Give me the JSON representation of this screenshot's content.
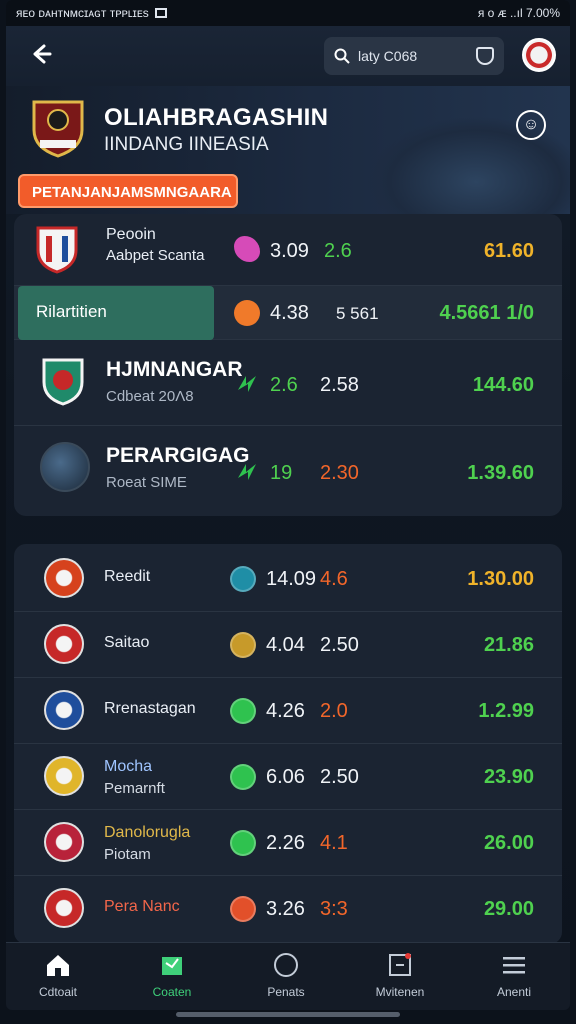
{
  "statusbar": {
    "left_text": "ᴙᴇᴏ ᴅᴀʜᴛɴᴍᴄɪᴀɢᴛ ᴛᴘᴘʟɪᴇs",
    "right_text": "ᴙ ᴏ ᴁ ..ıl 7.00%"
  },
  "search": {
    "text": "laty C068"
  },
  "hero": {
    "title": "OLIAHBRAGASHIN",
    "subtitle": "IINDANG IINEASIA",
    "badge": "PETANJANJAMSMNGAARA"
  },
  "featured": [
    {
      "name1": "Peooin",
      "name2": "Aabpet Scanta",
      "v1": "3.09",
      "v2": "2.6",
      "v3": "61.60",
      "v2_color": "#4fd14f",
      "v3_color": "#f0b32a",
      "icon_color": "#d64bb8"
    },
    {
      "name1": "Rilartitien",
      "name2": "",
      "v1": "4.38",
      "v2": "5 561",
      "v3": "4.5661 1/0",
      "v2_color": "#f0f3f7",
      "v3_color": "#4fd14f",
      "icon_color": "#f07a2a"
    },
    {
      "name1": "HJMNANGAR",
      "name2": "Cdbeat 20Ʌ8",
      "v1": "",
      "v2": "2.6",
      "v2b": "2.58",
      "v3": "144.60",
      "v2_color": "#4fd14f",
      "v3_color": "#4fd14f",
      "icon_color": "#2fc24f"
    },
    {
      "name1": "PERARGIGAG",
      "name2": "Roeat SIME",
      "v1": "",
      "v2": "19",
      "v2b": "2.30",
      "v3": "1.39.60",
      "v2_color": "#4fd14f",
      "v3_color": "#4fd14f",
      "icon_color": "#2fc24f"
    }
  ],
  "list": [
    {
      "name1": "Reedit",
      "name2": "",
      "v1": "14.09",
      "v2": "4.6",
      "v3": "1.30.00",
      "v2_color": "#f2662a",
      "v3_color": "#f0b32a",
      "icon_color": "#1f8ea6",
      "logo_color": "#d6421d"
    },
    {
      "name1": "Saitao",
      "name2": "",
      "v1": "4.04",
      "v2": "2.50",
      "v3": "21.86",
      "v2_color": "#f0f3f7",
      "v3_color": "#4fd14f",
      "icon_color": "#c79a2a",
      "logo_color": "#c62828"
    },
    {
      "name1": "Rrenastagan",
      "name2": "",
      "v1": "4.26",
      "v2": "2.0",
      "v3": "1.2.99",
      "v2_color": "#f2662a",
      "v3_color": "#4fd14f",
      "icon_color": "#2fc24f",
      "logo_color": "#1f4e9c"
    },
    {
      "name1": "Mocha",
      "name2": "Pemarnft",
      "v1": "6.06",
      "v2": "2.50",
      "v3": "23.90",
      "v2_color": "#f0f3f7",
      "v3_color": "#4fd14f",
      "icon_color": "#2fc24f",
      "logo_color": "#e0b52a"
    },
    {
      "name1": "Danolorugla",
      "name2": "Piotam",
      "v1": "2.26",
      "v2": "4.1",
      "v3": "26.00",
      "v2_color": "#f2662a",
      "v3_color": "#4fd14f",
      "icon_color": "#2fc24f",
      "logo_color": "#b8223a"
    },
    {
      "name1": "Pera Nanc",
      "name2": "",
      "v1": "3.26",
      "v2": "3:3",
      "v3": "29.00",
      "v2_color": "#f2662a",
      "v3_color": "#4fd14f",
      "icon_color": "#e2502a",
      "logo_color": "#c62828"
    }
  ],
  "nav": [
    {
      "label": "Cdtoait",
      "icon": "home-icon"
    },
    {
      "label": "Coaten",
      "icon": "card-icon"
    },
    {
      "label": "Penats",
      "icon": "circle-icon"
    },
    {
      "label": "Mvitenen",
      "icon": "notice-icon"
    },
    {
      "label": "Anenti",
      "icon": "menu-icon"
    }
  ]
}
